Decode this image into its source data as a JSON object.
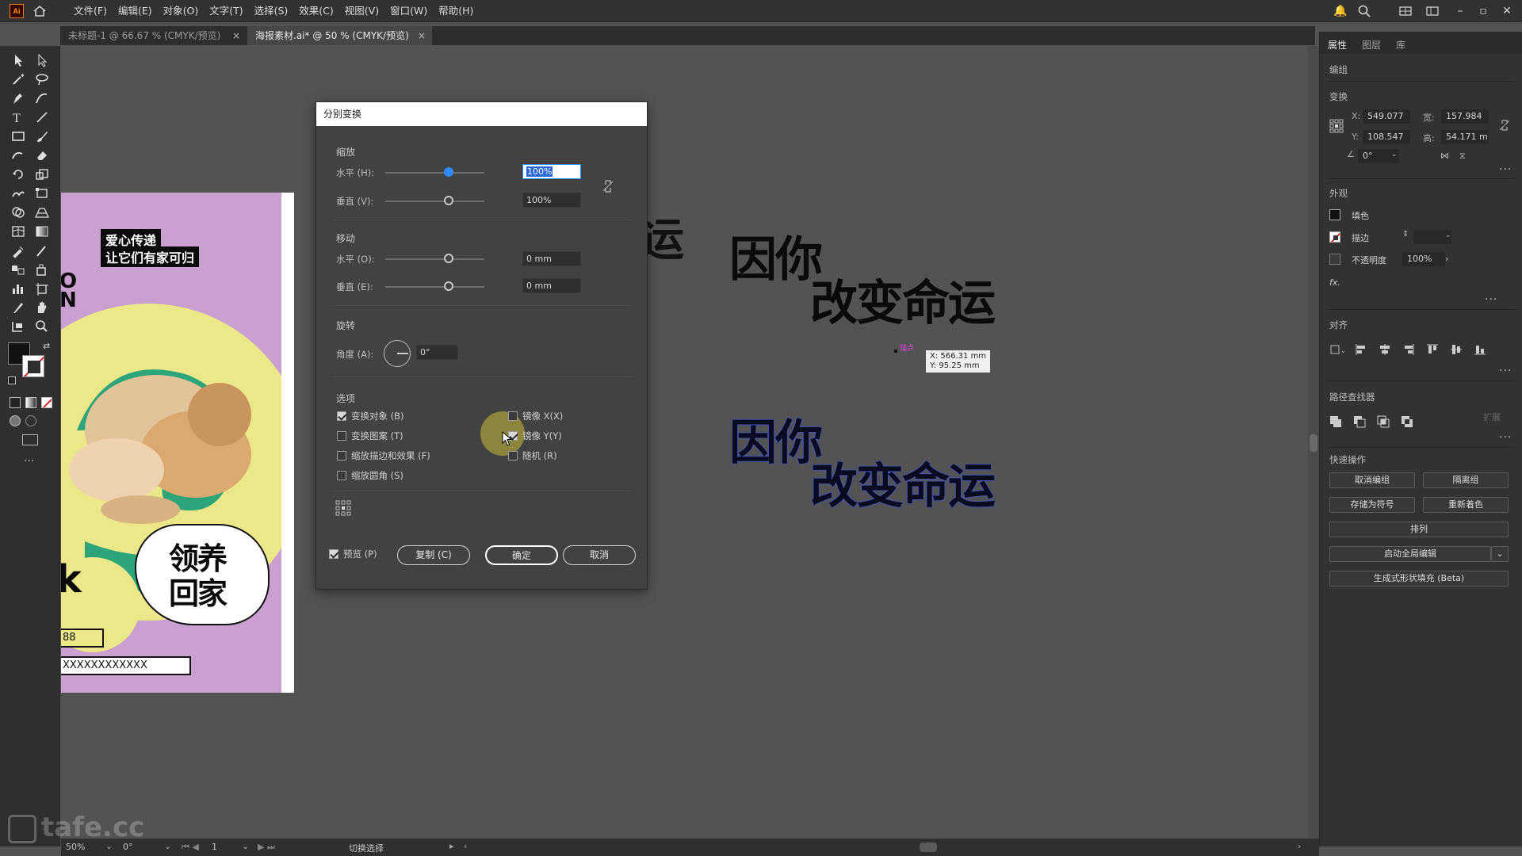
{
  "app": {
    "logo": "Ai"
  },
  "menu": [
    "文件(F)",
    "编辑(E)",
    "对象(O)",
    "文字(T)",
    "选择(S)",
    "效果(C)",
    "视图(V)",
    "窗口(W)",
    "帮助(H)"
  ],
  "tabs": [
    {
      "label": "未标题-1 @ 66.67 % (CMYK/预览)",
      "close": "×"
    },
    {
      "label": "海报素材.ai* @ 50 % (CMYK/预览)",
      "close": "×"
    }
  ],
  "poster": {
    "badge_line1": "爱心传递",
    "badge_line2": "让它们有家可归",
    "side_letters": "O\nN",
    "bubble_line1": "领养",
    "bubble_line2": "回家",
    "partial_char": "k",
    "phone_fragment": "88",
    "address_fragment": "XXXXXXXXXXXX"
  },
  "canvas_text": {
    "partial_char": "运",
    "group1_line1": "因你",
    "group1_line2": "改变命运",
    "group2_line1": "因你",
    "group2_line2": "改变命运",
    "anchor_label": "锚点",
    "coord_x": "X: 566.31 mm",
    "coord_y": "Y: 95.25 mm"
  },
  "dialog": {
    "title": "分别变换",
    "scale": {
      "label": "缩放",
      "h_label": "水平 (H):",
      "h_value": "100%",
      "v_label": "垂直 (V):",
      "v_value": "100%"
    },
    "move": {
      "label": "移动",
      "h_label": "水平 (O):",
      "h_value": "0 mm",
      "v_label": "垂直 (E):",
      "v_value": "0 mm"
    },
    "rotate": {
      "label": "旋转",
      "angle_label": "角度 (A):",
      "angle_value": "0°"
    },
    "options": {
      "label": "选项",
      "transform_objects": {
        "label": "变换对象 (B)",
        "checked": true
      },
      "transform_patterns": {
        "label": "变换图案 (T)",
        "checked": false
      },
      "scale_strokes": {
        "label": "缩放描边和效果 (F)",
        "checked": false
      },
      "scale_corners": {
        "label": "缩放圆角 (S)",
        "checked": false
      },
      "reflect_x": {
        "label": "镜像 X(X)",
        "checked": false
      },
      "reflect_y": {
        "label": "镜像 Y(Y)",
        "checked": true
      },
      "random": {
        "label": "随机 (R)",
        "checked": false
      }
    },
    "preview": {
      "label": "预览 (P)",
      "checked": true
    },
    "copy_button": "复制 (C)",
    "ok_button": "确定",
    "cancel_button": "取消"
  },
  "panel": {
    "tabs": [
      "属性",
      "图层",
      "库"
    ],
    "group_label": "编组",
    "transform": {
      "label": "变换",
      "x_label": "X:",
      "x_value": "549.077",
      "y_label": "Y:",
      "y_value": "108.547",
      "w_label": "宽:",
      "w_value": "157.984",
      "h_label": "高:",
      "h_value": "54.171 m",
      "angle_value": "0°"
    },
    "appearance": {
      "label": "外观",
      "fill_label": "填色",
      "stroke_label": "描边",
      "opacity_label": "不透明度",
      "opacity_value": "100%",
      "fx_label": "fx."
    },
    "align_label": "对齐",
    "pathfinder_label": "路径查找器",
    "pathfinder_expand": "扩展",
    "quick_actions": {
      "label": "快速操作",
      "ungroup": "取消编组",
      "isolate": "隔离组",
      "save_symbol": "存储为符号",
      "recolor": "重新着色",
      "arrange": "排列",
      "global_edit": "启动全局编辑",
      "generative": "生成式形状填充 (Beta)"
    }
  },
  "statusbar": {
    "zoom": "50%",
    "rotation": "0°",
    "artboard_num": "1",
    "tool": "切换选择"
  },
  "watermark": "tafe.cc",
  "colors": {
    "accent": "#2f8cff",
    "artboard_bg": "#c9a0d0",
    "poster_yellow": "#ece88a",
    "poster_green": "#2ea47a"
  }
}
